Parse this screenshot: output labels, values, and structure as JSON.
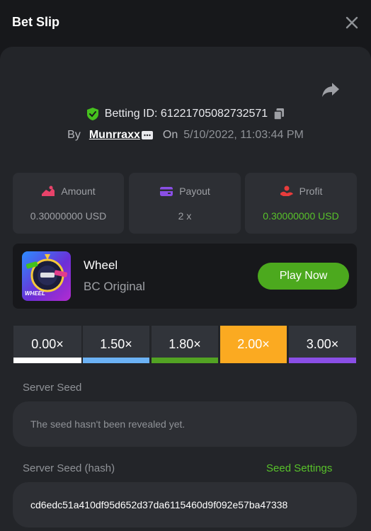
{
  "header": {
    "title": "Bet Slip"
  },
  "bet": {
    "id_label": "Betting ID: 6122170508273257​1",
    "by_label": "By",
    "user": "Munrraxx",
    "on_label": "On",
    "date": "5/10/2022, 11:03:44 PM"
  },
  "stats": [
    {
      "label": "Amount",
      "value": "0.30000000 USD",
      "icon": "amount-icon",
      "color": "#e8436a"
    },
    {
      "label": "Payout",
      "value": "2 x",
      "icon": "payout-card-icon",
      "color": "#8a4fe6"
    },
    {
      "label": "Profit",
      "value": "0.30000000 USD",
      "icon": "profit-icon",
      "color": "#e83c3c"
    }
  ],
  "game": {
    "name": "Wheel",
    "subtitle": "BC Original",
    "thumb_label": "WHEEL",
    "play_label": "Play Now"
  },
  "multipliers": [
    {
      "label": "0.00×",
      "color": "#ffffff",
      "active": false
    },
    {
      "label": "1.50×",
      "color": "#6cb2f5",
      "active": false
    },
    {
      "label": "1.80×",
      "color": "#52a323",
      "active": false
    },
    {
      "label": "2.00×",
      "color": "#fbaa21",
      "active": true
    },
    {
      "label": "3.00×",
      "color": "#8a4fe6",
      "active": false
    }
  ],
  "seeds": {
    "server_seed_label": "Server Seed",
    "server_seed_value": "The seed hasn't been revealed yet.",
    "hash_label": "Server Seed (hash)",
    "hash_value": "cd6edc51a410df95d652d37da6115460d9f092e57ba47338",
    "settings_label": "Seed Settings"
  },
  "colors": {
    "accent_green": "#58c22a",
    "panel": "#232529",
    "card": "#2d2f34"
  }
}
